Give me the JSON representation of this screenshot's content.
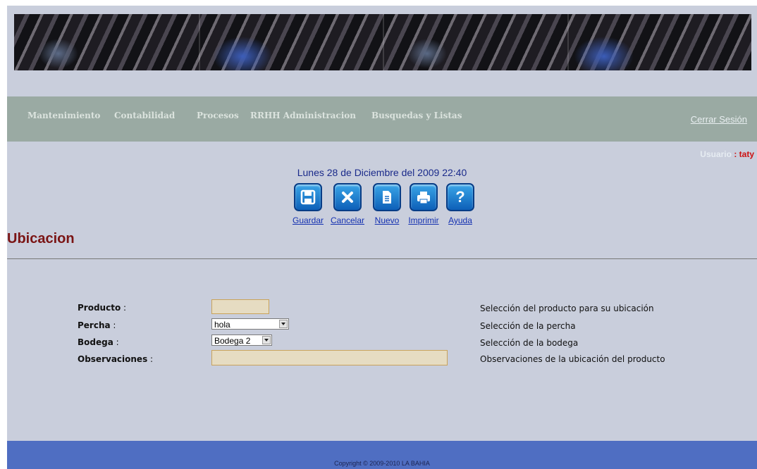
{
  "nav": {
    "items": [
      "Mantenimiento",
      "Contabilidad",
      "Procesos",
      "RRHH Administracion",
      "Busquedas y Listas"
    ],
    "logout": "Cerrar Sesión"
  },
  "user": {
    "label": "Usuario",
    "sep": " : ",
    "name": "taty"
  },
  "datetime": "Lunes 28 de Diciembre del 2009 22:40",
  "toolbar": {
    "buttons": [
      {
        "label": "Guardar",
        "icon": "save-icon"
      },
      {
        "label": "Cancelar",
        "icon": "close-icon"
      },
      {
        "label": "Nuevo",
        "icon": "new-document-icon"
      },
      {
        "label": "Imprimir",
        "icon": "print-icon"
      },
      {
        "label": "Ayuda",
        "icon": "help-icon"
      }
    ]
  },
  "page_title": "Ubicacion",
  "form": {
    "fields": [
      {
        "label": "Producto",
        "colon": " :",
        "value": "",
        "help": "Selección del producto para su ubicación"
      },
      {
        "label": "Percha",
        "colon": " :",
        "value": "hola",
        "help": "Selección de la percha"
      },
      {
        "label": "Bodega",
        "colon": " :",
        "value": "Bodega 2",
        "help": "Selección de la bodega"
      },
      {
        "label": "Observaciones",
        "colon": " :",
        "value": "",
        "help": "Observaciones de la ubicación del producto"
      }
    ]
  },
  "footer": {
    "copyright": "Copyright © 2009-2010 LA BAHIA"
  },
  "colors": {
    "nav_bg": "#9aaaa3",
    "page_bg": "#c9cedc",
    "footer_bg": "#4f6ec2",
    "title": "#7a1414",
    "user_name": "#cc1111"
  }
}
